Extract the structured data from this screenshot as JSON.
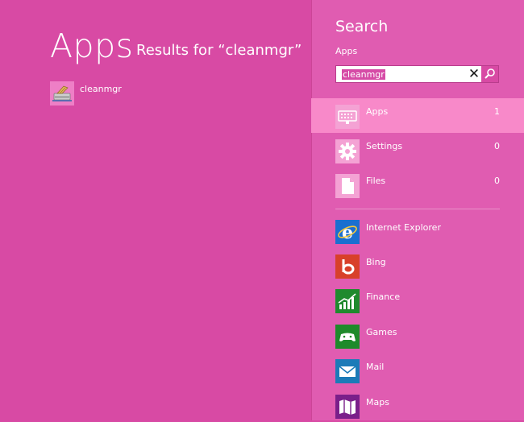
{
  "results": {
    "heading": "Apps",
    "subheading": "Results for “cleanmgr”",
    "items": [
      {
        "label": "cleanmgr",
        "icon": "disk-cleanup-icon"
      }
    ]
  },
  "search": {
    "title": "Search",
    "scope_label": "Apps",
    "query": "cleanmgr",
    "clear_icon": "close-icon",
    "search_icon": "search-icon",
    "scopes": [
      {
        "name": "Apps",
        "count": "1",
        "icon": "keyboard-icon",
        "selected": true
      },
      {
        "name": "Settings",
        "count": "0",
        "icon": "gear-icon",
        "selected": false
      },
      {
        "name": "Files",
        "count": "0",
        "icon": "document-icon",
        "selected": false
      }
    ],
    "apps": [
      {
        "name": "Internet Explorer",
        "icon": "internet-explorer-icon",
        "color": "#1a6fd0"
      },
      {
        "name": "Bing",
        "icon": "bing-icon",
        "color": "#d8402a"
      },
      {
        "name": "Finance",
        "icon": "finance-icon",
        "color": "#1f8a2e"
      },
      {
        "name": "Games",
        "icon": "games-icon",
        "color": "#1e8a2a"
      },
      {
        "name": "Mail",
        "icon": "mail-icon",
        "color": "#1c7bb8"
      },
      {
        "name": "Maps",
        "icon": "maps-icon",
        "color": "#7a1f8a"
      }
    ]
  },
  "colors": {
    "accent": "#d84aa4",
    "pane": "#e05cb1",
    "selected_row": "#f889c9"
  }
}
